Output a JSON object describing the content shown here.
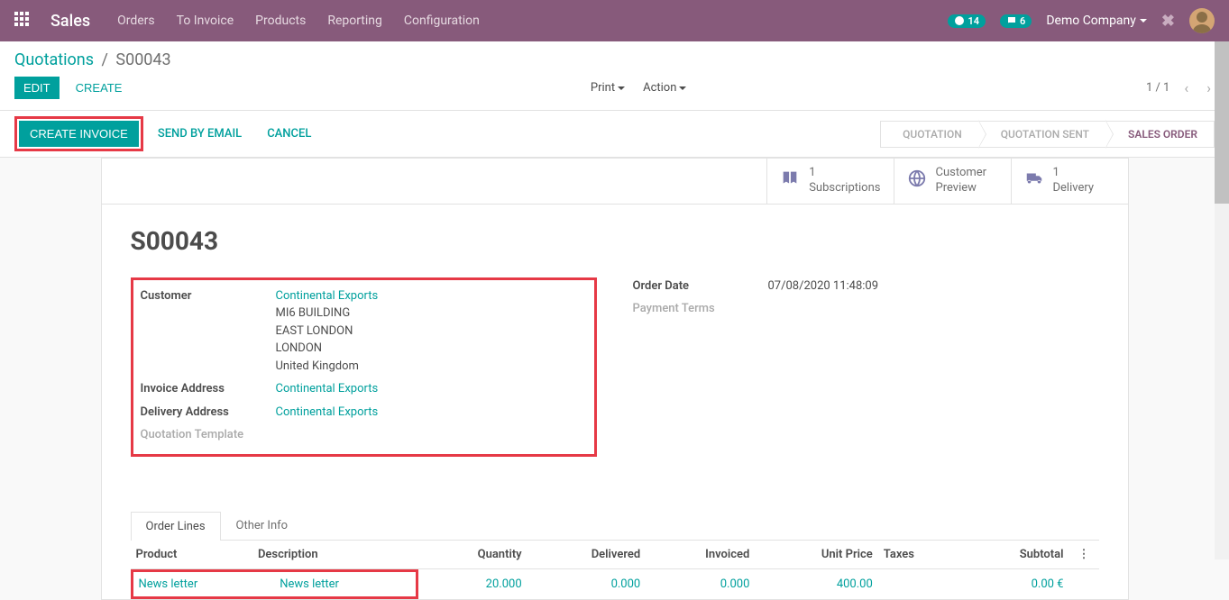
{
  "nav": {
    "brand": "Sales",
    "menu": [
      "Orders",
      "To Invoice",
      "Products",
      "Reporting",
      "Configuration"
    ],
    "activity_count": "14",
    "message_count": "6",
    "company": "Demo Company"
  },
  "breadcrumb": {
    "parent": "Quotations",
    "current": "S00043"
  },
  "buttons": {
    "edit": "EDIT",
    "create": "CREATE",
    "print": "Print",
    "action": "Action",
    "create_invoice": "CREATE INVOICE",
    "send_email": "SEND BY EMAIL",
    "cancel": "CANCEL"
  },
  "pager": {
    "text": "1 / 1"
  },
  "status_steps": {
    "quotation": "QUOTATION",
    "quotation_sent": "QUOTATION SENT",
    "sales_order": "SALES ORDER"
  },
  "stat_buttons": {
    "subscriptions": {
      "value": "1",
      "label": "Subscriptions"
    },
    "customer_preview": {
      "label1": "Customer",
      "label2": "Preview"
    },
    "delivery": {
      "value": "1",
      "label": "Delivery"
    }
  },
  "record": {
    "title": "S00043",
    "labels": {
      "customer": "Customer",
      "invoice_address": "Invoice Address",
      "delivery_address": "Delivery Address",
      "quotation_template": "Quotation Template",
      "order_date": "Order Date",
      "payment_terms": "Payment Terms"
    },
    "customer_name": "Continental Exports",
    "addr1": "MI6 BUILDING",
    "addr2": "EAST LONDON",
    "addr3": "LONDON",
    "addr4": "United Kingdom",
    "invoice_address": "Continental Exports",
    "delivery_address": "Continental Exports",
    "order_date": "07/08/2020 11:48:09"
  },
  "tabs": {
    "order_lines": "Order Lines",
    "other_info": "Other Info"
  },
  "table": {
    "headers": {
      "product": "Product",
      "description": "Description",
      "quantity": "Quantity",
      "delivered": "Delivered",
      "invoiced": "Invoiced",
      "unit_price": "Unit Price",
      "taxes": "Taxes",
      "subtotal": "Subtotal"
    },
    "row": {
      "product": "News letter",
      "description": "News letter",
      "quantity": "20.000",
      "delivered": "0.000",
      "invoiced": "0.000",
      "unit_price": "400.00",
      "taxes": "",
      "subtotal": "0.00 €"
    }
  }
}
